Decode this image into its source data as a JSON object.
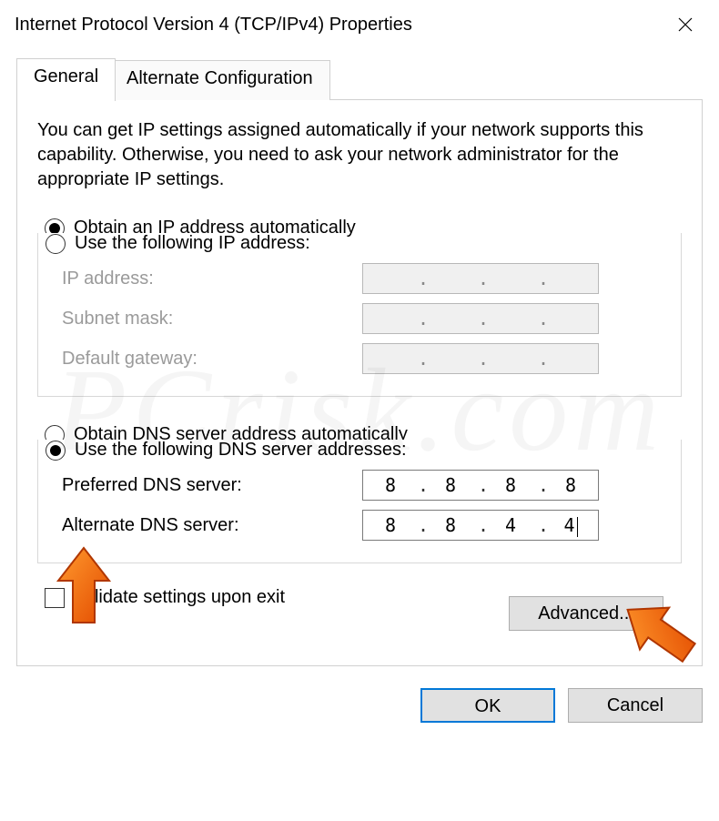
{
  "window": {
    "title": "Internet Protocol Version 4 (TCP/IPv4) Properties"
  },
  "tabs": {
    "general": "General",
    "alternate": "Alternate Configuration"
  },
  "intro": "You can get IP settings assigned automatically if your network supports this capability. Otherwise, you need to ask your network administrator for the appropriate IP settings.",
  "ip_section": {
    "auto_label": "Obtain an IP address automatically",
    "manual_label": "Use the following IP address:",
    "selected": "auto",
    "fields": {
      "ip": {
        "label": "IP address:",
        "value": [
          "",
          "",
          "",
          ""
        ]
      },
      "subnet": {
        "label": "Subnet mask:",
        "value": [
          "",
          "",
          "",
          ""
        ]
      },
      "gateway": {
        "label": "Default gateway:",
        "value": [
          "",
          "",
          "",
          ""
        ]
      }
    }
  },
  "dns_section": {
    "auto_label": "Obtain DNS server address automatically",
    "manual_label": "Use the following DNS server addresses:",
    "selected": "manual",
    "fields": {
      "preferred": {
        "label": "Preferred DNS server:",
        "value": [
          "8",
          "8",
          "8",
          "8"
        ]
      },
      "alternate": {
        "label": "Alternate DNS server:",
        "value": [
          "8",
          "8",
          "4",
          "4"
        ]
      }
    }
  },
  "validate": {
    "label": "Validate settings upon exit",
    "checked": false
  },
  "advanced": "Advanced...",
  "buttons": {
    "ok": "OK",
    "cancel": "Cancel"
  },
  "watermark": "PCrisk.com"
}
